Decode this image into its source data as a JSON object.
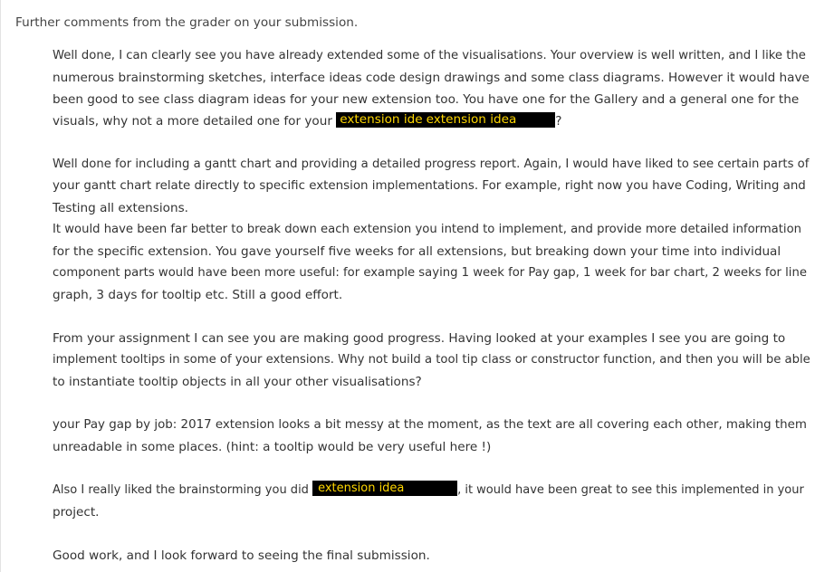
{
  "heading": "Further comments from the grader on your submission.",
  "paragraphs": [
    {
      "lines": [
        "Well done, I can clearly see you have already extended some of the visualisations. Your overview is well written, and I like the",
        "numerous brainstorming sketches, interface ideas code design drawings and some class diagrams. However it would have",
        "been good to see class diagram ideas for your new extension too. You have one for the Gallery and a general one for the"
      ],
      "last_line_before": "visuals, why not a more detailed one for your ",
      "redaction_text_a": "extension ide",
      "redaction_text_b": "extension idea",
      "last_line_after": "?"
    },
    {
      "lines": [
        "Well done for including a gantt chart and providing a detailed progress report. Again, I would have liked to see certain parts of",
        "your gantt chart relate directly to specific extension implementations. For example, right now you have Coding, Writing and",
        "Testing all extensions.",
        "It would have been far better to break down each extension you intend to implement, and provide more detailed information",
        "for the specific extension. You gave yourself five weeks for all extensions, but breaking down your time into individual",
        "component parts would have been more useful: for example saying 1 week for Pay gap, 1 week for bar chart, 2 weeks for line",
        "graph, 3 days for tooltip etc. Still a good effort."
      ]
    },
    {
      "lines": [
        "From your assignment I can see you are making good progress. Having looked at your examples I see you are going to",
        "implement tooltips in some of your extensions. Why not build a tool tip class or constructor function, and then you will be able",
        "to instantiate tooltip objects in all your other visualisations?"
      ]
    },
    {
      "lines": [
        "your Pay gap by job: 2017 extension looks a bit messy at the moment, as the text are all covering each other, making them",
        "unreadable in some places. (hint: a tooltip would be very useful here !)"
      ]
    },
    {
      "first_line_before": "Also I really liked the brainstorming you did ",
      "redaction_text": "extension idea",
      "first_line_after": ", it would have been great to see this implemented in your",
      "lines": [
        "project."
      ]
    },
    {
      "lines": [
        "Good work, and I look forward to seeing the final submission."
      ]
    }
  ]
}
